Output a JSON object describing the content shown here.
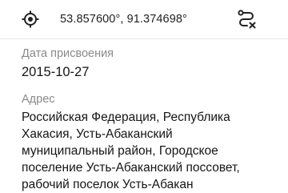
{
  "header": {
    "locate_icon": "crosshair-gps-icon",
    "coordinates": "53.857600°, 91.374698°",
    "route_icon": "route-clear-icon"
  },
  "fields": {
    "assignment_date": {
      "label": "Дата присвоения",
      "value": "2015-10-27"
    },
    "address": {
      "label": "Адрес",
      "value": "Российская Федерация, Республика Хакасия, Усть-Абаканский муниципальный район, Городское поселение Усть-Абаканский поссовет, рабочий поселок Усть-Абакан"
    }
  }
}
